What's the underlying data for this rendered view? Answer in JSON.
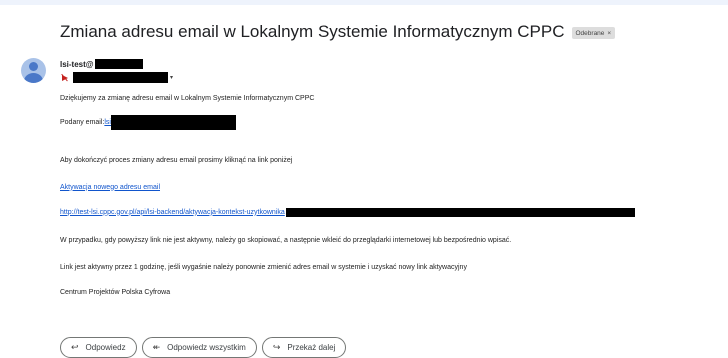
{
  "email": {
    "subject": "Zmiana adresu email w Lokalnym Systemie Informatycznym CPPC",
    "label_chip": "Odebrane",
    "label_chip_close": "×",
    "sender_prefix": "lsi-test@",
    "to_caret": "▾",
    "body": {
      "greeting": "Dziękujemy za zmianę adresu email w Lokalnym Systemie Informatycznym CPPC",
      "email_label": "Podany email: ",
      "email_value_prefix": "lsi",
      "instruction": "Aby dokończyć proces zmiany adresu email prosimy kliknąć na link poniżej",
      "activation_link_text": "Aktywacja nowego adresu email",
      "activation_url_prefix": "http://test-lsi.cppc.gov.pl/api/lsi-backend/aktywacja-kontekst-uzytkownika",
      "fallback_note": "W przypadku, gdy powyższy link nie jest aktywny, należy go skopiować, a następnie wkleić do przeglądarki internetowej lub bezpośrednio wpisać.",
      "expiry_note": "Link jest aktywny przez 1 godzinę, jeśli wygaśnie należy ponownie zmienić adres email w systemie i uzyskać nowy link aktywacyjny",
      "signature": "Centrum Projektów Polska Cyfrowa"
    }
  },
  "actions": {
    "reply": {
      "label": "Odpowiedz",
      "icon": "↩"
    },
    "reply_all": {
      "label": "Odpowiedz wszystkim",
      "icon": "↞"
    },
    "forward": {
      "label": "Przekaż dalej",
      "icon": "↪"
    }
  },
  "icons": {
    "avatar": "default-user-avatar",
    "importance": "unimportant-icon"
  },
  "colors": {
    "link": "#1155cc",
    "avatar_bg": "#a9c2e8",
    "avatar_fg": "#4a78c8",
    "chip_bg": "#dddddd"
  }
}
